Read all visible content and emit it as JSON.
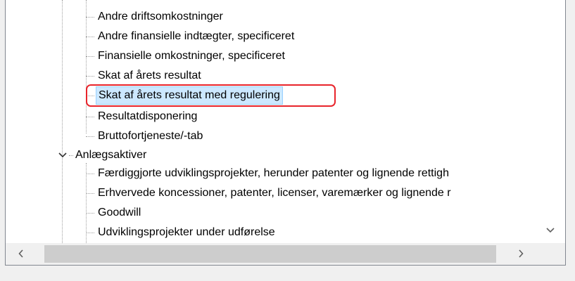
{
  "tree": {
    "group1_items": [
      "Andre driftsomkostninger",
      "Andre finansielle indtægter, specificeret",
      "Finansielle omkostninger, specificeret",
      "Skat af årets resultat",
      "Skat af årets resultat med regulering",
      "Resultatdisponering",
      "Bruttofortjeneste/-tab"
    ],
    "group2_label": "Anlægsaktiver",
    "group2_items": [
      "Færdiggjorte udviklingsprojekter, herunder patenter og lignende rettigh",
      "Erhvervede koncessioner, patenter, licenser, varemærker og lignende r",
      "Goodwill",
      "Udviklingsprojekter under udførelse"
    ],
    "selected_item": "Skat af årets resultat med regulering"
  },
  "icons": {
    "expander": "chevron-down-icon",
    "scroll_down": "scroll-down-arrow-icon",
    "scroll_left": "scroll-left-arrow-icon",
    "scroll_right": "scroll-right-arrow-icon"
  },
  "colors": {
    "selection_bg": "#cce8ff",
    "selection_border": "#99d1ff",
    "highlight_annotation": "#e8242b"
  }
}
